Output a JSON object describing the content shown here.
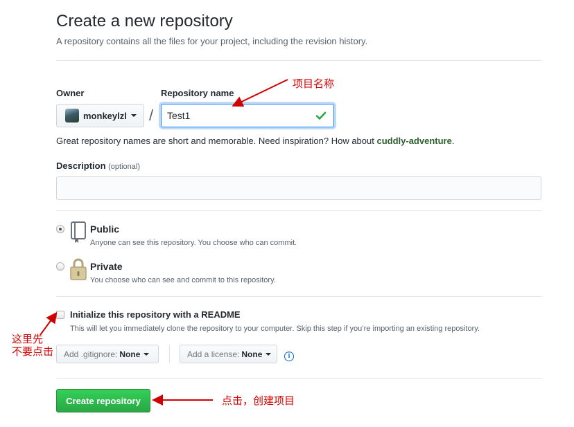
{
  "header": {
    "title": "Create a new repository",
    "subtitle": "A repository contains all the files for your project, including the revision history."
  },
  "owner": {
    "label": "Owner",
    "name": "monkeylzl"
  },
  "separator": "/",
  "repo_name": {
    "label": "Repository name",
    "value": "Test1"
  },
  "hint": {
    "prefix": "Great repository names are short and memorable. Need inspiration? How about ",
    "suggestion": "cuddly-adventure",
    "suffix": "."
  },
  "description": {
    "label": "Description",
    "optional": "(optional)",
    "value": ""
  },
  "visibility": {
    "public": {
      "title": "Public",
      "note": "Anyone can see this repository. You choose who can commit.",
      "selected": true
    },
    "private": {
      "title": "Private",
      "note": "You choose who can see and commit to this repository.",
      "selected": false
    }
  },
  "readme": {
    "label": "Initialize this repository with a README",
    "note": "This will let you immediately clone the repository to your computer. Skip this step if you’re importing an existing repository.",
    "checked": false
  },
  "gitignore": {
    "label": "Add .gitignore:",
    "value": "None"
  },
  "license": {
    "label": "Add a license:",
    "value": "None"
  },
  "info_icon": "i",
  "submit": {
    "label": "Create repository"
  },
  "annotations": {
    "name": "项目名称",
    "readme_line1": "这里先",
    "readme_line2": "不要点击",
    "create": "点击，创建项目"
  },
  "colors": {
    "accent": "#2188ff",
    "primary_button": "#28a745",
    "annotation": "#d10000",
    "suggestion": "#2c5e2e"
  }
}
